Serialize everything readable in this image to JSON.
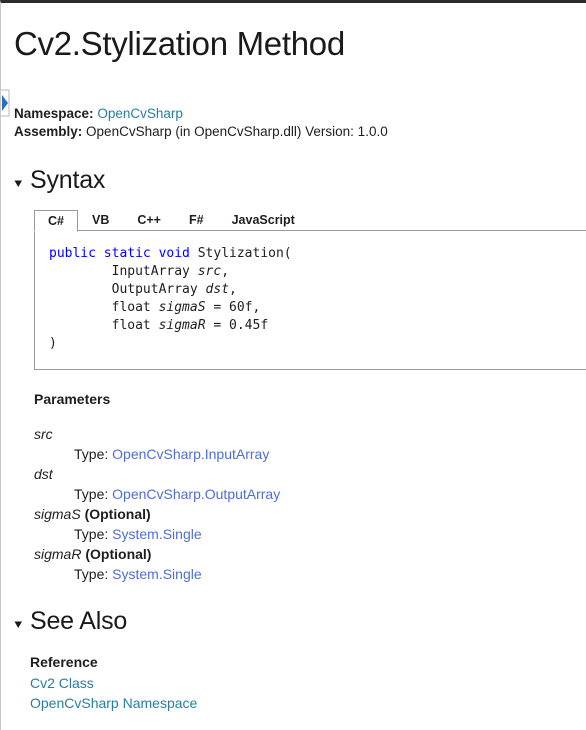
{
  "page": {
    "title": "Cv2.Stylization Method"
  },
  "sidebar_toggle": {
    "icon": "chevron-right-icon",
    "color": "#2a6fc4"
  },
  "meta": {
    "namespace_label": "Namespace:",
    "namespace_value": "OpenCvSharp",
    "assembly_label": "Assembly:",
    "assembly_value": "OpenCvSharp (in OpenCvSharp.dll) Version: 1.0.0"
  },
  "syntax": {
    "heading": "Syntax",
    "triangle_icon": "triangle-down-icon",
    "tabs": [
      {
        "label": "C#",
        "active": true
      },
      {
        "label": "VB",
        "active": false
      },
      {
        "label": "C++",
        "active": false
      },
      {
        "label": "F#",
        "active": false
      },
      {
        "label": "JavaScript",
        "active": false
      }
    ],
    "code_lines": [
      {
        "segments": [
          {
            "text": "public static void ",
            "style": "keyword"
          },
          {
            "text": "Stylization(",
            "style": "plain"
          }
        ]
      },
      {
        "segments": [
          {
            "text": "        InputArray ",
            "style": "plain"
          },
          {
            "text": "src",
            "style": "param"
          },
          {
            "text": ",",
            "style": "plain"
          }
        ]
      },
      {
        "segments": [
          {
            "text": "        OutputArray ",
            "style": "plain"
          },
          {
            "text": "dst",
            "style": "param"
          },
          {
            "text": ",",
            "style": "plain"
          }
        ]
      },
      {
        "segments": [
          {
            "text": "        float ",
            "style": "plain"
          },
          {
            "text": "sigmaS",
            "style": "param"
          },
          {
            "text": " = 60f,",
            "style": "plain"
          }
        ]
      },
      {
        "segments": [
          {
            "text": "        float ",
            "style": "plain"
          },
          {
            "text": "sigmaR",
            "style": "param"
          },
          {
            "text": " = 0.45f",
            "style": "plain"
          }
        ]
      },
      {
        "segments": [
          {
            "text": ")",
            "style": "plain"
          }
        ]
      }
    ]
  },
  "parameters": {
    "title": "Parameters",
    "type_label": "Type: ",
    "items": [
      {
        "name": "src",
        "optional": "",
        "type": "OpenCvSharp.InputArray"
      },
      {
        "name": "dst",
        "optional": "",
        "type": "OpenCvSharp.OutputArray"
      },
      {
        "name": "sigmaS",
        "optional": " (Optional)",
        "type": "System.Single"
      },
      {
        "name": "sigmaR",
        "optional": " (Optional)",
        "type": "System.Single"
      }
    ]
  },
  "see_also": {
    "heading": "See Also",
    "triangle_icon": "triangle-down-icon",
    "reference_title": "Reference",
    "links": [
      {
        "label": "Cv2 Class"
      },
      {
        "label": "OpenCvSharp Namespace"
      }
    ]
  },
  "colors": {
    "link_teal": "#2a7d9c",
    "link_blue": "#4f6fd0",
    "keyword_blue": "#0000ff",
    "text": "#1e1e1e",
    "border": "#9a9a9a",
    "top_bar": "#2b2b2b"
  }
}
